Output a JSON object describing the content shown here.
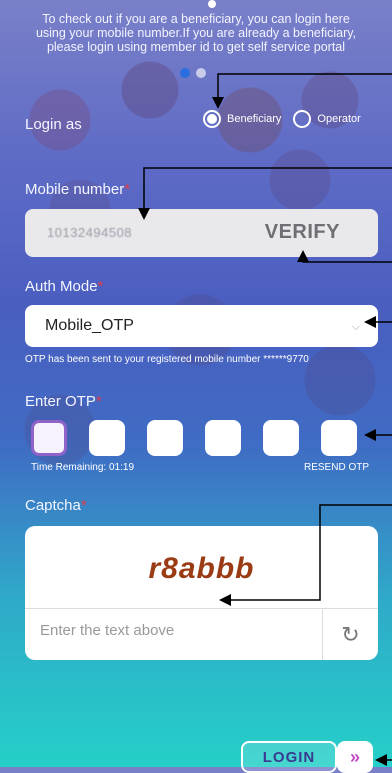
{
  "intro": {
    "line1": "To check out if you are a beneficiary, you can login here",
    "line2": "using your mobile number.If you are already a beneficiary,",
    "line3": "please login using member id to get self service portal"
  },
  "login_as": {
    "label": "Login as",
    "options": [
      {
        "label": "Beneficiary",
        "selected": true
      },
      {
        "label": "Operator",
        "selected": false
      }
    ]
  },
  "mobile": {
    "label": "Mobile number",
    "required_mark": "*",
    "value": "10132494508",
    "verify_label": "VERIFY"
  },
  "auth_mode": {
    "label": "Auth Mode",
    "required_mark": "*",
    "value": "Mobile_OTP",
    "chevron_icon": "chevron-down-icon"
  },
  "otp_note": "OTP has been sent to your registered mobile number ******9770",
  "otp": {
    "label": "Enter OTP",
    "required_mark": "*",
    "time_remaining": "Time Remaining: 01:19",
    "resend_label": "RESEND OTP"
  },
  "captcha": {
    "label": "Captcha",
    "required_mark": "*",
    "code": "r8abbb",
    "placeholder": "Enter the text above",
    "refresh_icon": "refresh-icon"
  },
  "login": {
    "label": "LOGIN",
    "go_icon": "double-chevron-right-icon"
  },
  "colors": {
    "accent": "#2a6ee0",
    "required": "#e23a4a",
    "captcha_text": "#9a3b14",
    "otp_focus": "#8f63c9"
  }
}
